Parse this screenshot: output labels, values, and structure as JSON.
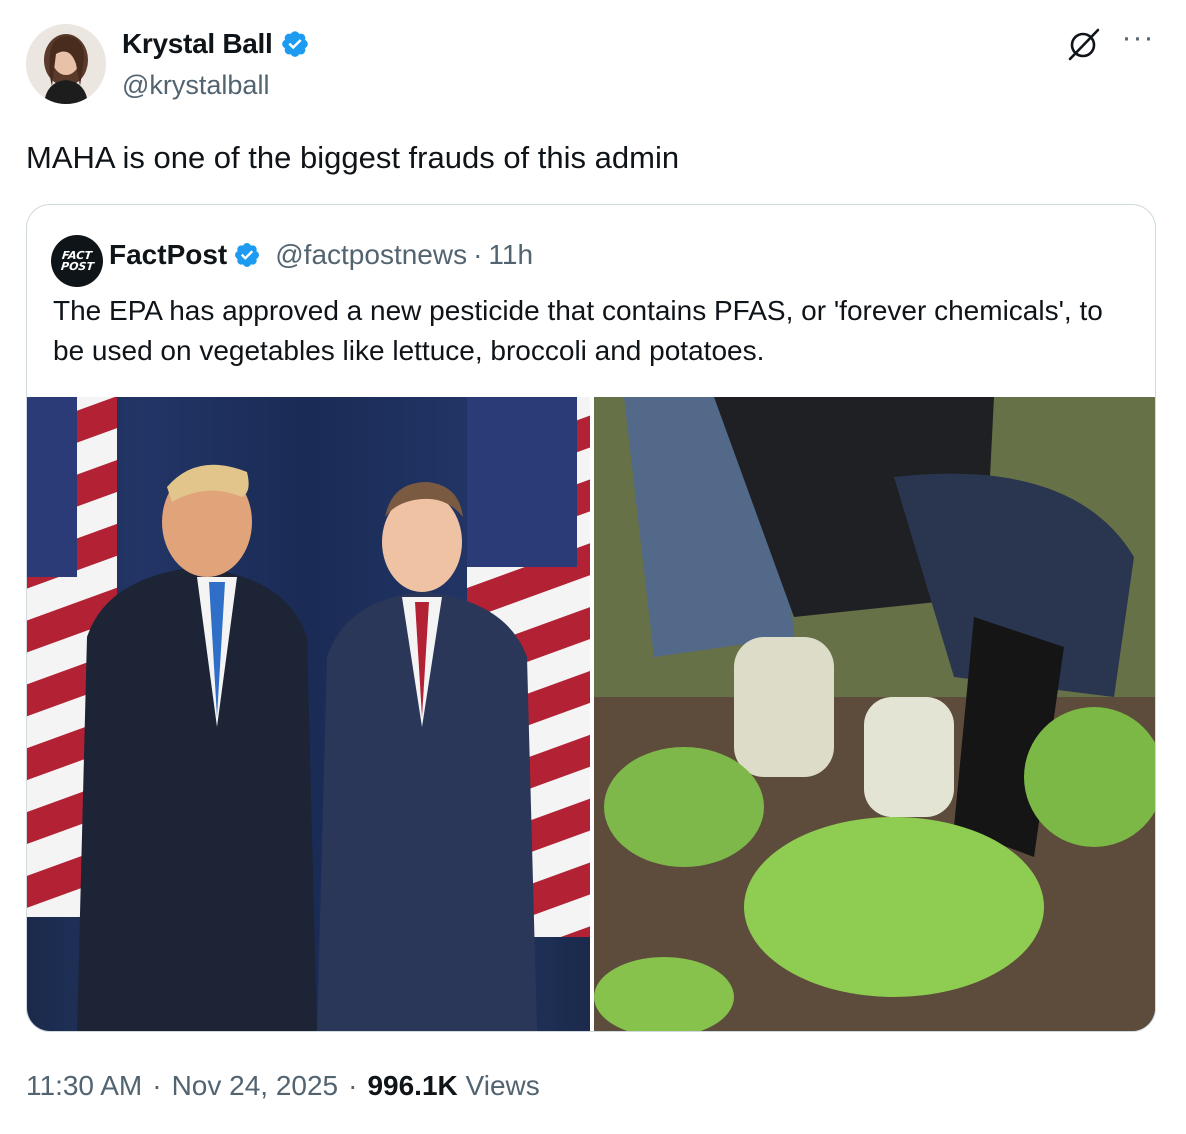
{
  "author": {
    "name": "Krystal Ball",
    "handle": "@krystalball"
  },
  "tweet": {
    "text": "MAHA is one of the biggest frauds of this admin"
  },
  "quoted": {
    "name": "FactPost",
    "handle": "@factpostnews",
    "separator": "·",
    "time": "11h",
    "logo_line1": "FACT",
    "logo_line2": "POST",
    "text": "The EPA has approved a new pesticide that contains PFAS, or 'forever chemicals', to be used on vegetables like lettuce, broccoli and potatoes."
  },
  "footer": {
    "time": "11:30 AM",
    "sep1": "·",
    "date": "Nov 24, 2025",
    "sep2": "·",
    "views_count": "996.1K",
    "views_label": "Views"
  },
  "icons": {
    "verified": "verified-badge-icon",
    "grok": "grok-icon",
    "more": "more-icon"
  },
  "colors": {
    "verified_blue": "#1d9bf0",
    "secondary_text": "#536471",
    "border": "#cfd9de"
  }
}
